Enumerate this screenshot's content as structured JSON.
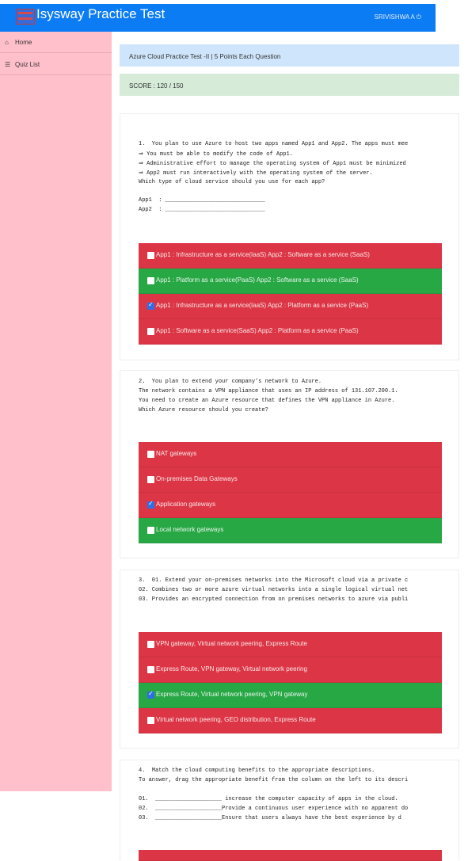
{
  "app": {
    "brand": "Isysway Practice Test",
    "user": "SRIVISHWA A ⏻"
  },
  "sidebar": {
    "items": [
      {
        "icon": "⌂",
        "label": "Home"
      },
      {
        "icon": "☰",
        "label": "Quiz List"
      }
    ]
  },
  "quiz": {
    "title": "Azure Cloud Practice Test -II | 5 Points Each Question",
    "score": "SCORE : 120 / 150"
  },
  "questions": [
    {
      "lines": [
        "1.  You plan to use Azure to host two apps named App1 and App2. The apps must mee",
        "⇒ You must be able to modify the code of App1.",
        "⇒ Administrative effort to manage the operating system of App1 must be minimized",
        "⇒ App2 must run interactively with the operating system of the server.",
        "Which type of cloud service should you use for each app?",
        "",
        "App1  : ______________________________",
        "App2  : ______________________________"
      ],
      "options": [
        {
          "label": "App1 : Infrastructure as a service(IaaS) App2 : Software as a service (SaaS)",
          "state": "red",
          "checked": false
        },
        {
          "label": "App1 : Platform as a service(PaaS) App2 : Software as a service (SaaS)",
          "state": "green",
          "checked": false
        },
        {
          "label": "App1 : Infrastructure as a service(IaaS) App2 : Platform as a service (PaaS)",
          "state": "red",
          "checked": true
        },
        {
          "label": "App1 : Software as a service(SaaS) App2 : Platform as a service (PaaS)",
          "state": "red",
          "checked": false
        }
      ]
    },
    {
      "lines": [
        "2.  You plan to extend your company's network to Azure.",
        "The network contains a VPN appliance that uses an IP address of 131.107.200.1.",
        "You need to create an Azure resource that defines the VPN appliance in Azure.",
        "Which Azure resource should you create?"
      ],
      "options": [
        {
          "label": "NAT gateways",
          "state": "red",
          "checked": false
        },
        {
          "label": "On-premises Data Gateways",
          "state": "red",
          "checked": false
        },
        {
          "label": "Application gateways",
          "state": "red",
          "checked": true
        },
        {
          "label": "Local network gateways",
          "state": "green",
          "checked": false
        }
      ]
    },
    {
      "lines": [
        "3.  01. Extend your on-premises networks into the Microsoft cloud via a private c",
        "02. Combines two or more azure virtual networks into a single logical virtual net",
        "03. Provides an encrypted connection from on premises networks to azure via publi"
      ],
      "options": [
        {
          "label": "VPN gateway, Virtual network peering, Express Route",
          "state": "red",
          "checked": false
        },
        {
          "label": "Express Route, VPN gateway, Virtual network peering",
          "state": "red",
          "checked": false
        },
        {
          "label": "Express Route, Virtual network peering, VPN gateway",
          "state": "green",
          "checked": true
        },
        {
          "label": "Virtual network peering, GEO distribution, Express Route",
          "state": "red",
          "checked": false
        }
      ]
    },
    {
      "lines": [
        "4.  Match the cloud computing benefits to the appropriate descriptions.",
        "To answer, drag the appropriate benefit from the column on the left to its descri",
        "",
        "01.  ____________________ increase the computer capacity of apps in the cloud.",
        "02.  ____________________Provide a continuous user experience with no apparent do",
        "03.  ____________________Ensure that users always have the best experience by d"
      ],
      "options": []
    }
  ],
  "colors": {
    "topbar": "#0b7cf3",
    "sidebar": "#ffc0cb",
    "wrong": "#dc3545",
    "correct": "#28a745"
  }
}
